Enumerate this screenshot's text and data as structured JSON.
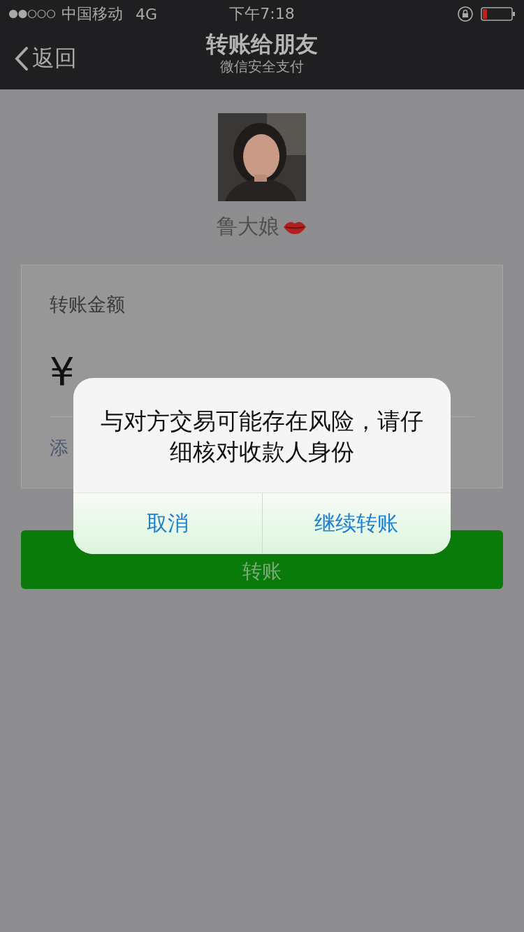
{
  "status_bar": {
    "carrier": "中国移动",
    "network": "4G",
    "time": "下午7:18"
  },
  "nav": {
    "back": "返回",
    "title": "转账给朋友",
    "subtitle": "微信安全支付"
  },
  "payee": {
    "name": "鲁大娘"
  },
  "amount_card": {
    "label": "转账金额",
    "currency": "¥",
    "note_link": "添"
  },
  "submit_button": "转账",
  "dialog": {
    "message": "与对方交易可能存在风险，请仔细核对收款人身份",
    "buttons": [
      {
        "label": "取消"
      },
      {
        "label": "继续转账"
      }
    ]
  }
}
